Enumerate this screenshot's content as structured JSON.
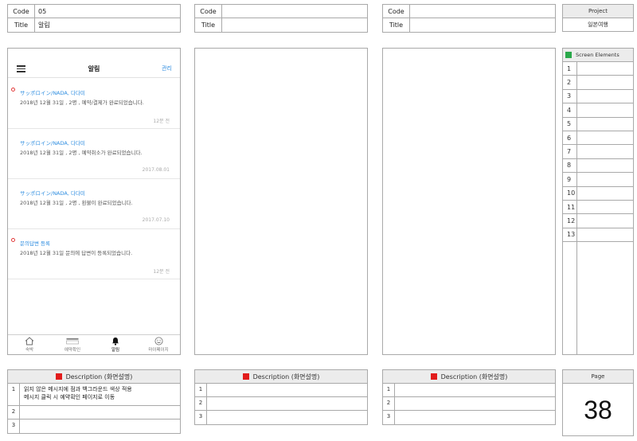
{
  "header": [
    {
      "code_label": "Code",
      "code_value": "05",
      "title_label": "Title",
      "title_value": "알림"
    },
    {
      "code_label": "Code",
      "code_value": "",
      "title_label": "Title",
      "title_value": ""
    },
    {
      "code_label": "Code",
      "code_value": "",
      "title_label": "Title",
      "title_value": ""
    }
  ],
  "project": {
    "label": "Project",
    "value": "일본여행"
  },
  "phone": {
    "title": "알림",
    "manage_label": "관리",
    "notifications": [
      {
        "title": "サッポロイン/NADA, 다다미",
        "body": "2018년 12월 31일 , 2명 , 예약/결제가 완료되었습니다.",
        "time": "12분 전",
        "unread": true
      },
      {
        "title": "サッポロイン/NADA, 다다미",
        "body": "2018년 12월 31일 , 2명 , 예약취소가 완료되었습니다.",
        "time": "2017.08.01",
        "unread": false
      },
      {
        "title": "サッポロイン/NADA, 다다미",
        "body": "2018년 12월 31일 , 2명 , 환불이 완료되었습니다.",
        "time": "2017.07.10",
        "unread": false
      },
      {
        "title": "문의답변 등록",
        "body": "2018년 12월 31일 문의에 답변이 등록되었습니다.",
        "time": "12분 전",
        "unread": true
      }
    ],
    "tabs": [
      {
        "label": "숙박",
        "icon": "home-icon",
        "active": false
      },
      {
        "label": "예약확인",
        "icon": "reservation-icon",
        "active": false
      },
      {
        "label": "알림",
        "icon": "bell-icon",
        "active": true
      },
      {
        "label": "마이페이지",
        "icon": "smiley-icon",
        "active": false
      }
    ]
  },
  "screen_elements": {
    "title": "Screen Elements",
    "rows": [
      "1",
      "2",
      "3",
      "4",
      "5",
      "6",
      "7",
      "8",
      "9",
      "10",
      "11",
      "12",
      "13"
    ]
  },
  "descriptions": [
    {
      "title": "Description (화면설명)",
      "rows": [
        {
          "n": "1",
          "text": "읽지 않은 메시지에 점과 백그라운드 색상 적용"
        },
        {
          "n": "",
          "text": "메시지 클릭 시 예약확인 페이지로 이동"
        },
        {
          "n": "2",
          "text": ""
        },
        {
          "n": "3",
          "text": ""
        }
      ]
    },
    {
      "title": "Description (화면설명)",
      "rows": [
        {
          "n": "1",
          "text": ""
        },
        {
          "n": "2",
          "text": ""
        },
        {
          "n": "3",
          "text": ""
        }
      ]
    },
    {
      "title": "Description (화면설명)",
      "rows": [
        {
          "n": "1",
          "text": ""
        },
        {
          "n": "2",
          "text": ""
        },
        {
          "n": "3",
          "text": ""
        }
      ]
    }
  ],
  "page": {
    "label": "Page",
    "number": "38"
  },
  "colors": {
    "link": "#2e8de0",
    "unread_dot": "#e23a3a",
    "elements_marker": "#2aa84a",
    "description_marker": "#e21c1c"
  }
}
